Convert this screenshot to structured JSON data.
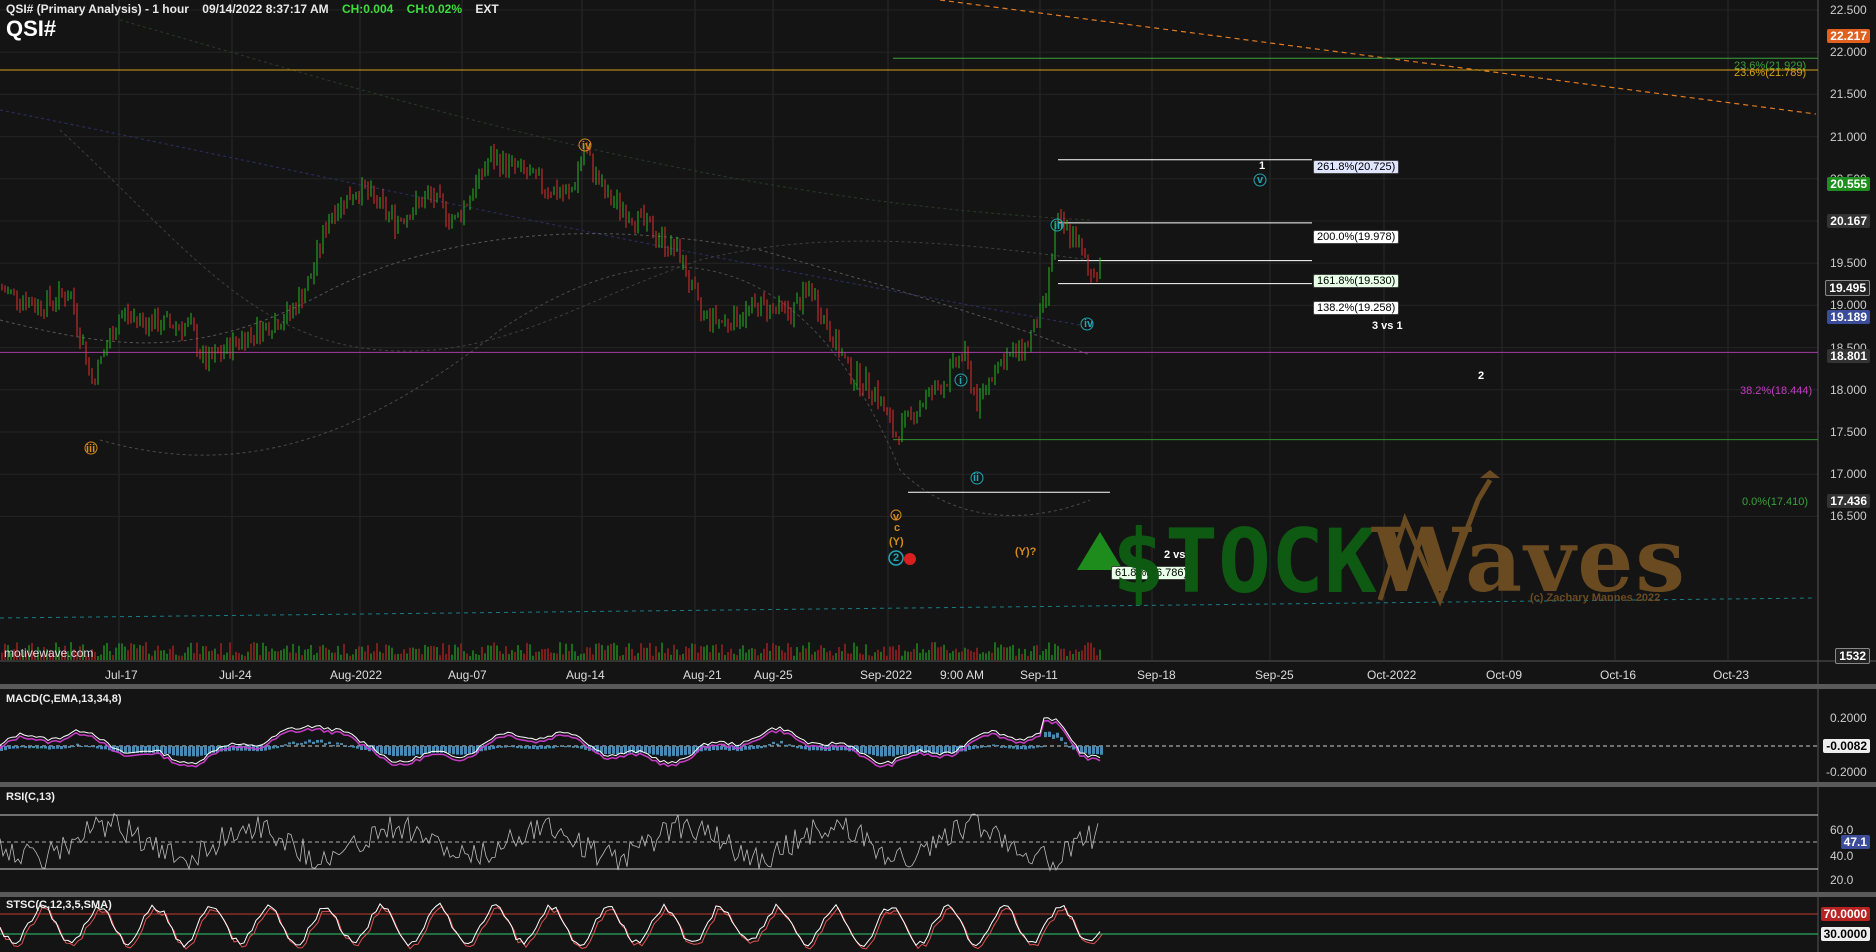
{
  "header": {
    "title": "QSI# (Primary Analysis) - 1 hour",
    "datetime": "09/14/2022 8:37:17 AM",
    "change": "CH:0.004",
    "change_pct": "CH:0.02%",
    "session": "EXT",
    "symbol": "QSI#"
  },
  "watermark": "motivewave.com",
  "price_axis": [
    "22.500",
    "22.000",
    "21.500",
    "21.000",
    "20.500",
    "20.000",
    "19.500",
    "19.000",
    "18.500",
    "18.000",
    "17.500",
    "17.000",
    "16.500"
  ],
  "price_tags": [
    {
      "label": "22.217",
      "color": "#e06020"
    },
    {
      "label": "20.555",
      "color": "#1c8f1c"
    },
    {
      "label": "20.167",
      "color": "#333333"
    },
    {
      "label": "19.495",
      "color": "#222222"
    },
    {
      "label": "19.189",
      "color": "#3a4c9a"
    },
    {
      "label": "18.801",
      "color": "#333333"
    },
    {
      "label": "17.436",
      "color": "#333333"
    },
    {
      "label": "1532",
      "color": "#222222"
    }
  ],
  "fib_levels": [
    {
      "label": "261.8%(20.725)",
      "bg": "#dfe4ff"
    },
    {
      "label": "200.0%(19.978)",
      "bg": "#ffffff"
    },
    {
      "label": "161.8%(19.530)",
      "bg": "#e6ffe6"
    },
    {
      "label": "138.2%(19.258)",
      "bg": "#ffffff"
    },
    {
      "label": "61.8%(16.786)",
      "bg": "#e6ffe6"
    }
  ],
  "fib_text": [
    {
      "label": "23.6%(21.929)",
      "color": "#3aa13a"
    },
    {
      "label": "23.6%(21.789)",
      "color": "#d4a017"
    },
    {
      "label": "38.2%(18.444)",
      "color": "#c23cc2"
    },
    {
      "label": "0.0%(17.410)",
      "color": "#3aa13a"
    }
  ],
  "annotations": {
    "three_vs_one": "3 vs 1",
    "two_vs_one": "2 vs 1",
    "wave_1": "1",
    "wave_2": "2",
    "y_question": "(Y)?"
  },
  "wave_labels": [
    {
      "label": "iii",
      "color": "#d48a1c"
    },
    {
      "label": "iv",
      "color": "#d48a1c"
    },
    {
      "label": "v",
      "color": "#d48a1c"
    },
    {
      "label": "c",
      "color": "#d48a1c"
    },
    {
      "label": "(Y)",
      "color": "#d48a1c"
    },
    {
      "label": "2",
      "color": "#21a6b3"
    },
    {
      "label": "i",
      "color": "#21a6b3"
    },
    {
      "label": "ii",
      "color": "#21a6b3"
    },
    {
      "label": "iii",
      "color": "#21a6b3"
    },
    {
      "label": "iv",
      "color": "#21a6b3"
    },
    {
      "label": "v",
      "color": "#21a6b3"
    }
  ],
  "dates": [
    "Jul-17",
    "Jul-24",
    "Aug-2022",
    "Aug-07",
    "Aug-14",
    "Aug-21",
    "Aug-25",
    "Sep-2022",
    "9:00 AM",
    "Sep-11",
    "Sep-18",
    "Sep-25",
    "Oct-2022",
    "Oct-09",
    "Oct-16",
    "Oct-23"
  ],
  "indicators": {
    "macd": {
      "title": "MACD(C,EMA,13,34,8)",
      "axis": [
        "0.2000",
        "-0.0082",
        "-0.2000"
      ]
    },
    "rsi": {
      "title": "RSI(C,13)",
      "axis": [
        "60.0",
        "47.1",
        "40.0",
        "20.0"
      ]
    },
    "stsc": {
      "title": "STSC(C,12,3,5,SMA)",
      "axis": [
        "70.0000",
        "30.0000"
      ]
    }
  },
  "logo": {
    "stock": "$TOCK",
    "waves": "Waves",
    "copyright": "(c) Zachary Mannes 2022"
  },
  "colors": {
    "bull": "#22b922",
    "bear": "#e03030",
    "bg": "#141414",
    "grid": "#2a2a2a"
  }
}
